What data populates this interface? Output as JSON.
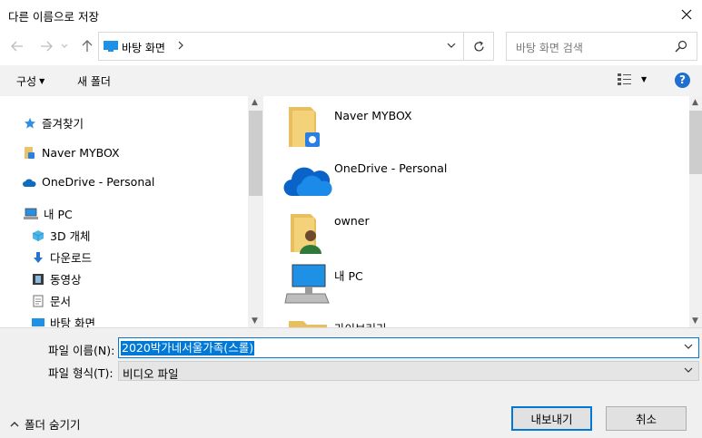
{
  "window": {
    "title": "다른 이름으로 저장"
  },
  "address": {
    "crumb": "바탕 화면"
  },
  "search": {
    "placeholder": "바탕 화면 검색"
  },
  "toolbar": {
    "organize_label": "구성",
    "new_folder_label": "새 폴더",
    "help_label": "?"
  },
  "navpane": {
    "items": [
      {
        "label": "즐겨찾기",
        "icon": "star-icon"
      },
      {
        "label": "Naver MYBOX",
        "icon": "folder-icon"
      },
      {
        "label": "OneDrive - Personal",
        "icon": "cloud-icon"
      },
      {
        "label": "내 PC",
        "icon": "computer-icon"
      },
      {
        "label": "3D 개체",
        "icon": "cube-icon"
      },
      {
        "label": "다운로드",
        "icon": "download-arrow-icon"
      },
      {
        "label": "동영상",
        "icon": "film-icon"
      },
      {
        "label": "문서",
        "icon": "document-icon"
      },
      {
        "label": "바탕 화면",
        "icon": "desktop-icon"
      }
    ]
  },
  "content": {
    "items": [
      {
        "label": "Naver MYBOX",
        "icon": "cloud-folder-icon"
      },
      {
        "label": "OneDrive - Personal",
        "icon": "onedrive-cloud-icon"
      },
      {
        "label": "owner",
        "icon": "user-folder-icon"
      },
      {
        "label": "내 PC",
        "icon": "computer-icon"
      },
      {
        "label": "라이브러리",
        "icon": "folder-icon"
      }
    ]
  },
  "form": {
    "filename_label": "파일 이름(N):",
    "filename_value": "2020박가네서울가족(스롤)",
    "filetype_label": "파일 형식(T):",
    "filetype_value": "비디오 파일"
  },
  "footer": {
    "hide_folders_label": "폴더 숨기기",
    "save_label": "내보내기",
    "cancel_label": "취소"
  },
  "colors": {
    "accent": "#0078d7",
    "help": "#1f6fcf"
  }
}
